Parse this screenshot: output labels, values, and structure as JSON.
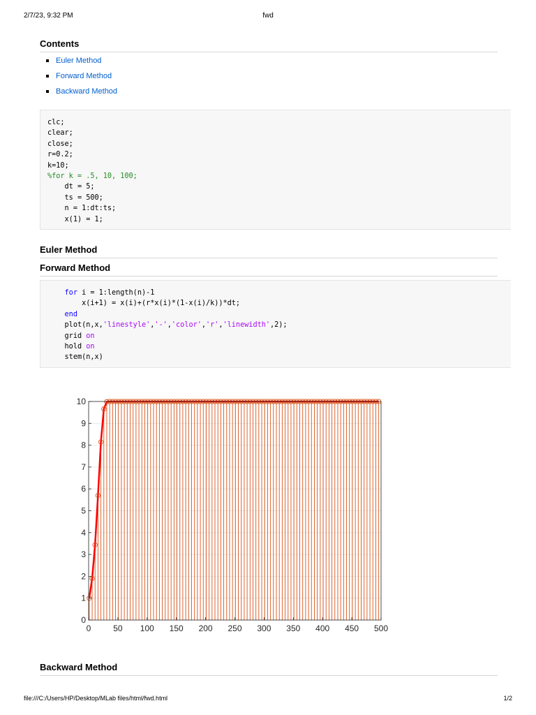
{
  "print_header": {
    "date": "2/7/23, 9:32 PM",
    "title": "fwd"
  },
  "print_footer": {
    "path": "file:///C:/Users/HP/Desktop/MLab files/html/fwd.html",
    "page": "1/2"
  },
  "contents": {
    "heading": "Contents",
    "items": [
      "Euler Method",
      "Forward Method",
      "Backward Method"
    ]
  },
  "code_block_1": {
    "lines": [
      {
        "indent": "",
        "tokens": [
          {
            "t": "plain",
            "v": "clc;"
          }
        ]
      },
      {
        "indent": "",
        "tokens": [
          {
            "t": "plain",
            "v": "clear;"
          }
        ]
      },
      {
        "indent": "",
        "tokens": [
          {
            "t": "plain",
            "v": "close;"
          }
        ]
      },
      {
        "indent": "",
        "tokens": [
          {
            "t": "plain",
            "v": "r=0.2;"
          }
        ]
      },
      {
        "indent": "",
        "tokens": [
          {
            "t": "plain",
            "v": "k=10;"
          }
        ]
      },
      {
        "indent": "",
        "tokens": [
          {
            "t": "cmt",
            "v": "%for k = .5, 10, 100;"
          }
        ]
      },
      {
        "indent": "    ",
        "tokens": [
          {
            "t": "plain",
            "v": "dt = 5;"
          }
        ]
      },
      {
        "indent": "    ",
        "tokens": [
          {
            "t": "plain",
            "v": "ts = 500;"
          }
        ]
      },
      {
        "indent": "    ",
        "tokens": [
          {
            "t": "plain",
            "v": "n = 1:dt:ts;"
          }
        ]
      },
      {
        "indent": "    ",
        "tokens": [
          {
            "t": "plain",
            "v": "x(1) = 1;"
          }
        ]
      }
    ]
  },
  "sections": {
    "euler": "Euler Method",
    "forward": "Forward Method",
    "backward": "Backward Method"
  },
  "code_block_2": {
    "lines": [
      {
        "indent": "    ",
        "tokens": [
          {
            "t": "kw",
            "v": "for"
          },
          {
            "t": "plain",
            "v": " i = 1:length(n)-1"
          }
        ]
      },
      {
        "indent": "        ",
        "tokens": [
          {
            "t": "plain",
            "v": "x(i+1) = x(i)+(r*x(i)*(1-x(i)/k))*dt;"
          }
        ]
      },
      {
        "indent": "    ",
        "tokens": [
          {
            "t": "kw",
            "v": "end"
          }
        ]
      },
      {
        "indent": "    ",
        "tokens": [
          {
            "t": "plain",
            "v": "plot(n,x,"
          },
          {
            "t": "str",
            "v": "'linestyle'"
          },
          {
            "t": "plain",
            "v": ","
          },
          {
            "t": "str",
            "v": "'-'"
          },
          {
            "t": "plain",
            "v": ","
          },
          {
            "t": "str",
            "v": "'color'"
          },
          {
            "t": "plain",
            "v": ","
          },
          {
            "t": "str",
            "v": "'r'"
          },
          {
            "t": "plain",
            "v": ","
          },
          {
            "t": "str",
            "v": "'linewidth'"
          },
          {
            "t": "plain",
            "v": ",2);"
          }
        ]
      },
      {
        "indent": "    ",
        "tokens": [
          {
            "t": "plain",
            "v": "grid "
          },
          {
            "t": "str",
            "v": "on"
          }
        ]
      },
      {
        "indent": "    ",
        "tokens": [
          {
            "t": "plain",
            "v": "hold "
          },
          {
            "t": "str",
            "v": "on"
          }
        ]
      },
      {
        "indent": "    ",
        "tokens": [
          {
            "t": "plain",
            "v": "stem(n,x)"
          }
        ]
      }
    ]
  },
  "colors": {
    "link": "#005fce",
    "keyword": "#0e00ff",
    "string": "#a709f5",
    "comment": "#228b22",
    "plot_line": "#ff0000",
    "stem": "#d95319"
  },
  "chart_data": {
    "type": "line",
    "series": [
      {
        "style": "line",
        "color": "#ff0000",
        "x": [
          1,
          6,
          11,
          16,
          21,
          26,
          31,
          36,
          41,
          46,
          51,
          56,
          61,
          66,
          71,
          76,
          81,
          86,
          91,
          96,
          101,
          106,
          111,
          116,
          121,
          126,
          131,
          136,
          141,
          146,
          151,
          156,
          161,
          166,
          171,
          176,
          181,
          186,
          191,
          196,
          201,
          206,
          211,
          216,
          221,
          226,
          231,
          236,
          241,
          246,
          251,
          256,
          261,
          266,
          271,
          276,
          281,
          286,
          291,
          296,
          301,
          306,
          311,
          316,
          321,
          326,
          331,
          336,
          341,
          346,
          351,
          356,
          361,
          366,
          371,
          376,
          381,
          386,
          391,
          396,
          401,
          406,
          411,
          416,
          421,
          426,
          431,
          436,
          441,
          446,
          451,
          456,
          461,
          466,
          471,
          476,
          481,
          486,
          491,
          496
        ],
        "y": [
          1,
          1.9,
          3.44,
          5.7,
          8.15,
          9.66,
          9.99,
          10,
          10,
          10,
          10,
          10,
          10,
          10,
          10,
          10,
          10,
          10,
          10,
          10,
          10,
          10,
          10,
          10,
          10,
          10,
          10,
          10,
          10,
          10,
          10,
          10,
          10,
          10,
          10,
          10,
          10,
          10,
          10,
          10,
          10,
          10,
          10,
          10,
          10,
          10,
          10,
          10,
          10,
          10,
          10,
          10,
          10,
          10,
          10,
          10,
          10,
          10,
          10,
          10,
          10,
          10,
          10,
          10,
          10,
          10,
          10,
          10,
          10,
          10,
          10,
          10,
          10,
          10,
          10,
          10,
          10,
          10,
          10,
          10,
          10,
          10,
          10,
          10,
          10,
          10,
          10,
          10,
          10,
          10,
          10,
          10,
          10,
          10,
          10,
          10,
          10,
          10,
          10,
          10
        ]
      },
      {
        "style": "stem",
        "color": "#d95319",
        "same_as_line": true
      }
    ],
    "xlim": [
      0,
      500
    ],
    "ylim": [
      0,
      10
    ],
    "xticks": [
      "0",
      "50",
      "100",
      "150",
      "200",
      "250",
      "300",
      "350",
      "400",
      "450",
      "500"
    ],
    "yticks": [
      "0",
      "1",
      "2",
      "3",
      "4",
      "5",
      "6",
      "7",
      "8",
      "9",
      "10"
    ],
    "grid": true
  }
}
